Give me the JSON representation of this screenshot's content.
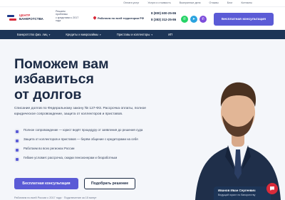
{
  "topbar": {
    "links": [
      "Оплата услуг",
      "Услуги и стоимость",
      "Выигранные дела",
      "Отзывы",
      "Блог",
      "Контакты"
    ]
  },
  "header": {
    "logo": {
      "line1": "Центр",
      "line2": "банкротства"
    },
    "tagline": [
      "Решаем",
      "проблемы",
      "с кредитами с 2017",
      "года"
    ],
    "region": "Работаем по всей территории РФ",
    "phones": [
      "8 (800) 600-25-86",
      "8 (383) 312-25-86"
    ],
    "messengers": [
      {
        "icon": "whatsapp-icon",
        "color": "#25d366"
      },
      {
        "icon": "telegram-icon",
        "color": "#2aa3df"
      },
      {
        "icon": "viber-icon",
        "color": "#7d4cdb"
      }
    ],
    "cta": "Бесплатная консультация"
  },
  "nav": {
    "items": [
      "Банкротство физ. лиц",
      "Кредиты и микрозаймы",
      "Приставы и коллекторы",
      "ИП"
    ]
  },
  "hero": {
    "title_lines": [
      "Поможем вам",
      "избавиться",
      "от долгов"
    ],
    "lead": "Списание долгов по Федеральному закону № 127-ФЗ. Рассрочка оплаты, полное юридическое сопровождение, защита от коллекторов и приставов.",
    "features": [
      "Полное сопровождение — юрист ведёт процедуру от заявления до решения суда",
      "Защита от коллекторов и приставов — берём общение с кредиторами на себя",
      "Работаем во всех регионах России",
      "Гибкие условия: рассрочка, скидки пенсионерам и безработным"
    ],
    "primary_button": "Бесплатная консультация",
    "secondary_button": "Подобрать решение",
    "footnote": "Работаем по всей России с 2017 года · Подключение за 15 минут"
  },
  "specialist": {
    "name": "Иванов Иван Сергеевич",
    "role": "Ведущий юрист по банкротству"
  },
  "colors": {
    "accent": "#5b5bd6",
    "navy": "#1d3557",
    "red": "#d92b3a"
  }
}
